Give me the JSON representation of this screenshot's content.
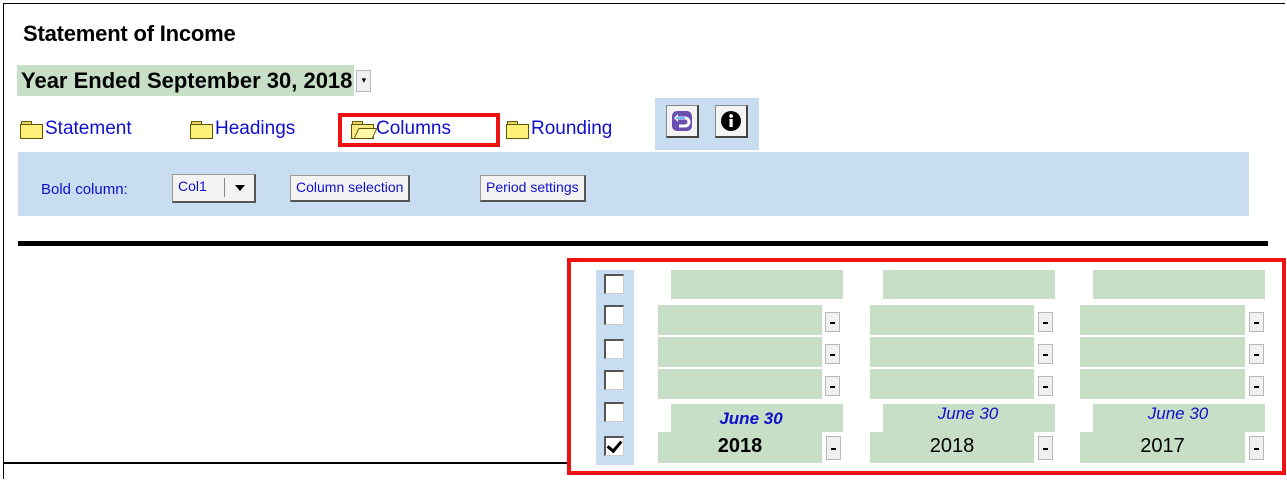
{
  "title": "Statement of Income",
  "period": {
    "label": "Year Ended September 30, 2018"
  },
  "tabs": [
    {
      "label": "Statement",
      "active": false
    },
    {
      "label": "Headings",
      "active": false
    },
    {
      "label": "Columns",
      "active": true
    },
    {
      "label": "Rounding",
      "active": false
    }
  ],
  "toolbar": {
    "buttons": [
      {
        "icon": "undo-arrow-icon"
      },
      {
        "icon": "info-icon"
      }
    ]
  },
  "options": {
    "bold_column_label": "Bold column:",
    "bold_column_value": "Col1",
    "column_selection_label": "Column selection",
    "period_settings_label": "Period settings"
  },
  "columns": [
    {
      "period": "June 30",
      "year": "2018",
      "bold": true
    },
    {
      "period": "June 30",
      "year": "2018",
      "bold": false
    },
    {
      "period": "June 30",
      "year": "2017",
      "bold": false
    }
  ],
  "row_checkboxes": [
    false,
    false,
    false,
    false,
    false,
    true
  ],
  "colors": {
    "heading_green": "#c6dfc6",
    "panel_blue": "#c8ddf0",
    "highlight_red": "#ee1111",
    "link_blue": "#1010cc"
  }
}
